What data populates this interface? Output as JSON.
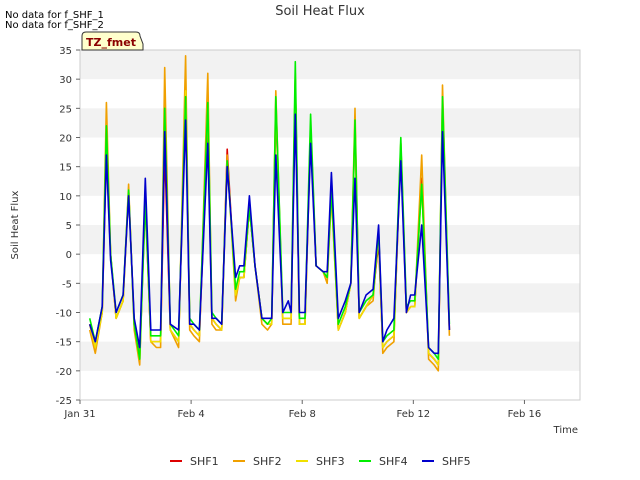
{
  "notes": [
    "No data for f_SHF_1",
    "No data for f_SHF_2"
  ],
  "chart_data": {
    "type": "line",
    "title": "Soil Heat Flux",
    "xlabel": "Time",
    "ylabel": "Soil Heat Flux",
    "badge": "TZ_fmet",
    "ylim": [
      -25,
      35
    ],
    "xlim": [
      0,
      18
    ],
    "yticks": [
      -25,
      -20,
      -15,
      -10,
      -5,
      0,
      5,
      10,
      15,
      20,
      25,
      30,
      35
    ],
    "xticks": [
      {
        "value": 0,
        "label": "Jan 31"
      },
      {
        "value": 4,
        "label": "Feb 4"
      },
      {
        "value": 8,
        "label": "Feb 8"
      },
      {
        "value": 12,
        "label": "Feb 12"
      },
      {
        "value": 16,
        "label": "Feb 16"
      }
    ],
    "grid_bands": true,
    "legend_position": "bottom",
    "x": [
      0.35,
      0.55,
      0.8,
      0.95,
      1.1,
      1.3,
      1.55,
      1.75,
      1.95,
      2.15,
      2.35,
      2.55,
      2.75,
      2.9,
      3.05,
      3.25,
      3.55,
      3.8,
      3.95,
      4.1,
      4.3,
      4.6,
      4.75,
      4.9,
      5.1,
      5.3,
      5.6,
      5.75,
      5.9,
      6.1,
      6.3,
      6.55,
      6.75,
      6.9,
      7.05,
      7.3,
      7.5,
      7.6,
      7.75,
      7.9,
      8.1,
      8.3,
      8.5,
      8.75,
      8.9,
      9.05,
      9.3,
      9.55,
      9.75,
      9.9,
      10.05,
      10.3,
      10.55,
      10.75,
      10.9,
      11.05,
      11.3,
      11.55,
      11.75,
      11.9,
      12.05,
      12.3,
      12.55,
      12.75,
      12.9,
      13.05,
      13.3,
      13.55,
      13.75,
      13.9,
      14.05,
      14.3,
      14.55,
      14.75,
      14.9,
      15.05,
      15.3,
      15.55,
      15.75,
      15.9,
      16.05,
      16.3,
      16.55,
      16.75,
      16.9,
      17.05,
      17.2
    ],
    "series": [
      {
        "name": "SHF1",
        "color": "#dd0000",
        "values": [
          -12,
          -16,
          -10,
          18,
          0,
          -11,
          -8,
          11,
          -12,
          -17,
          9,
          -15,
          -15,
          -15,
          18,
          -13,
          -15,
          28,
          -12,
          -13,
          -14,
          22,
          -11,
          -12,
          -13,
          18,
          -7,
          -4,
          -4,
          8,
          -2,
          -11,
          -12,
          -12,
          25,
          -11,
          -11,
          -11,
          30,
          -12,
          -12,
          21,
          -2,
          -3,
          -4,
          12,
          -13,
          -10,
          -5,
          22,
          -11,
          -9,
          -7,
          2,
          -16,
          -15,
          -14,
          18,
          -10,
          -9,
          -9,
          13,
          -17,
          -18,
          -19,
          25,
          -13
        ]
      },
      {
        "name": "SHF2",
        "color": "#f0a000",
        "values": [
          -13,
          -17,
          -10,
          26,
          0,
          -11,
          -8,
          12,
          -13,
          -19,
          11,
          -15,
          -16,
          -16,
          32,
          -13,
          -16,
          34,
          -13,
          -14,
          -15,
          31,
          -12,
          -13,
          -13,
          17,
          -8,
          -4,
          -4,
          8,
          -2,
          -12,
          -13,
          -12,
          28,
          -12,
          -12,
          -12,
          30,
          -12,
          -12,
          22,
          -2,
          -3,
          -5,
          10,
          -13,
          -10,
          -5,
          25,
          -11,
          -9,
          -8,
          4,
          -17,
          -16,
          -15,
          19,
          -10,
          -9,
          -9,
          17,
          -18,
          -19,
          -20,
          29,
          -14
        ]
      },
      {
        "name": "SHF3",
        "color": "#f0e000",
        "values": [
          -12,
          -16,
          -10,
          20,
          0,
          -11,
          -8,
          11,
          -12,
          -18,
          9,
          -15,
          -15,
          -15,
          24,
          -13,
          -15,
          28,
          -12,
          -13,
          -14,
          26,
          -11,
          -12,
          -13,
          16,
          -7,
          -4,
          -4,
          8,
          -2,
          -11,
          -12,
          -12,
          26,
          -11,
          -11,
          -11,
          31,
          -12,
          -12,
          22,
          -2,
          -3,
          -4,
          10,
          -13,
          -10,
          -5,
          22,
          -11,
          -9,
          -7,
          3,
          -16,
          -15,
          -14,
          19,
          -10,
          -9,
          -9,
          12,
          -17,
          -18,
          -19,
          26,
          -13
        ]
      },
      {
        "name": "SHF4",
        "color": "#00ee00",
        "values": [
          -11,
          -15,
          -9,
          22,
          0,
          -10,
          -7,
          11,
          -12,
          -18,
          9,
          -14,
          -14,
          -14,
          25,
          -12,
          -14,
          27,
          -11,
          -12,
          -13,
          26,
          -10,
          -11,
          -12,
          16,
          -6,
          -3,
          -3,
          8,
          -2,
          -11,
          -12,
          -11,
          27,
          -10,
          -10,
          -10,
          33,
          -11,
          -11,
          24,
          -2,
          -3,
          -4,
          11,
          -12,
          -9,
          -5,
          23,
          -10,
          -8,
          -7,
          4,
          -15,
          -14,
          -13,
          20,
          -9,
          -8,
          -8,
          12,
          -16,
          -17,
          -18,
          27,
          -12
        ]
      },
      {
        "name": "SHF5",
        "color": "#0000cc",
        "values": [
          -12,
          -15,
          -9,
          17,
          -1,
          -10,
          -7,
          10,
          -11,
          -16,
          13,
          -13,
          -13,
          -13,
          21,
          -12,
          -13,
          23,
          -12,
          -12,
          -13,
          19,
          -11,
          -11,
          -12,
          15,
          -4,
          -2,
          -2,
          10,
          -2,
          -11,
          -11,
          -11,
          17,
          -10,
          -8,
          -10,
          24,
          -10,
          -10,
          19,
          -2,
          -3,
          -3,
          14,
          -11,
          -8,
          -5,
          13,
          -10,
          -7,
          -6,
          5,
          -15,
          -13,
          -11,
          16,
          -10,
          -7,
          -7,
          5,
          -16,
          -17,
          -17,
          21,
          -13
        ]
      }
    ]
  }
}
